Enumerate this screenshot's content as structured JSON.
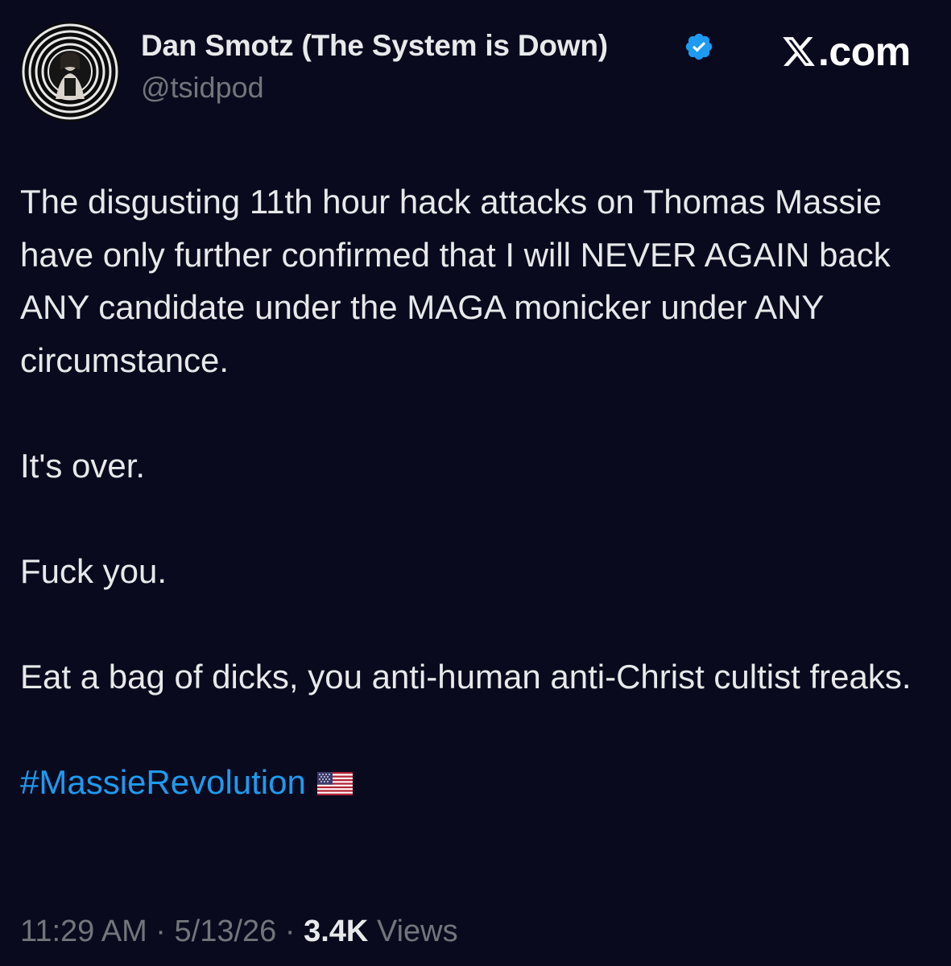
{
  "author": {
    "name": "Dan Smotz (The System is Down)",
    "handle": "@tsidpod",
    "verified": true,
    "verified_color": "#1d9bf0"
  },
  "brand": {
    "text": ".com",
    "icon": "x-logo-icon"
  },
  "tweet": {
    "paragraphs": [
      "The disgusting 11th hour hack attacks on Thomas Massie have only further confirmed that I will NEVER AGAIN back ANY candidate under the MAGA monicker under ANY circumstance.",
      "It's over.",
      "Fuck you.",
      "Eat a bag of dicks, you anti-human anti-Christ cultist freaks."
    ],
    "hashtag": "#MassieRevolution",
    "hashtag_emoji": "us-flag-icon"
  },
  "meta": {
    "time": "11:29 AM",
    "separator": "·",
    "date": "5/13/26",
    "views_count": "3.4K",
    "views_label": "Views"
  },
  "colors": {
    "background": "#0a0a1e",
    "text": "#e7e9ea",
    "secondary_text": "#71767b",
    "accent": "#1d9bf0"
  }
}
